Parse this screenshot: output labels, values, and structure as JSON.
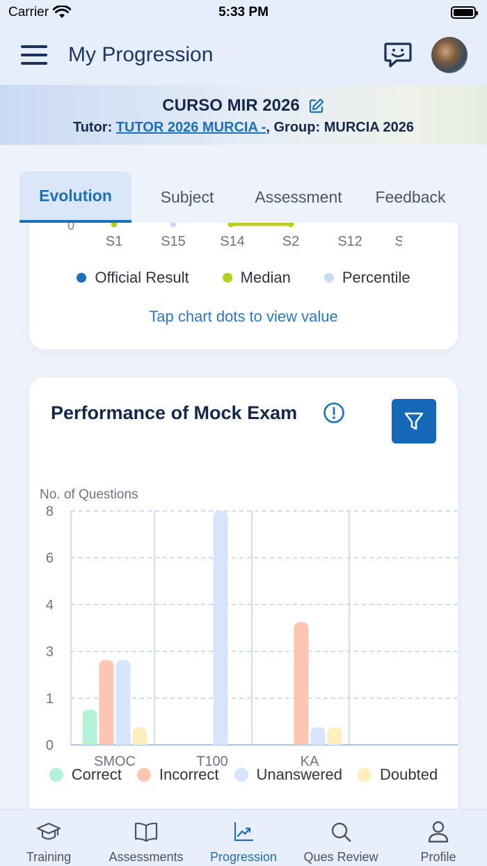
{
  "status_bar": {
    "carrier": "Carrier",
    "time": "5:33 PM"
  },
  "header": {
    "title": "My Progression",
    "menu_icon": "hamburger-menu-icon",
    "chat_icon": "chat-smile-icon"
  },
  "course": {
    "name": "CURSO MIR 2026",
    "tutor_prefix": "Tutor: ",
    "tutor_name": "TUTOR 2026 MURCIA -",
    "group_text": ", Group: MURCIA 2026"
  },
  "tabs": [
    {
      "label": "Evolution",
      "active": true
    },
    {
      "label": "Subject",
      "active": false
    },
    {
      "label": "Assessment",
      "active": false
    },
    {
      "label": "Feedback",
      "active": false
    }
  ],
  "evolution_card": {
    "y_tick_visible": "0",
    "x_labels": [
      "S1",
      "S15",
      "S14",
      "S2",
      "S12",
      "S"
    ],
    "legend": [
      {
        "label": "Official Result",
        "color": "#1d6fb8"
      },
      {
        "label": "Median",
        "color": "#b8cc22"
      },
      {
        "label": "Percentile",
        "color": "#c9dbf7"
      }
    ],
    "hint": "Tap chart dots to view value"
  },
  "performance_card": {
    "title": "Performance of Mock Exam",
    "info_icon": "info-circle-icon",
    "filter_icon": "filter-funnel-icon"
  },
  "chart_data": {
    "type": "bar",
    "title": "Performance of Mock Exam",
    "ylabel": "No. of Questions",
    "xlabel": "",
    "categories": [
      "SMOC",
      "T100",
      "KA"
    ],
    "y_ticks": [
      "0",
      "1",
      "3",
      "4",
      "6",
      "8"
    ],
    "ylim": [
      0,
      8
    ],
    "grid": true,
    "legend_position": "bottom",
    "series": [
      {
        "name": "Correct",
        "color": "#b5f0d8",
        "values": [
          1.2,
          0,
          0
        ]
      },
      {
        "name": "Incorrect",
        "color": "#fcc6b3",
        "values": [
          2.9,
          0,
          4.2
        ]
      },
      {
        "name": "Unanswered",
        "color": "#d6e5fb",
        "values": [
          2.9,
          8,
          0.6
        ]
      },
      {
        "name": "Doubted",
        "color": "#fdefbf",
        "values": [
          0.6,
          0,
          0.6
        ]
      }
    ]
  },
  "bottom_nav": [
    {
      "label": "Training",
      "icon": "graduation-cap-icon",
      "active": false
    },
    {
      "label": "Assessments",
      "icon": "open-book-icon",
      "active": false
    },
    {
      "label": "Progression",
      "icon": "line-chart-icon",
      "active": true
    },
    {
      "label": "Ques Review",
      "icon": "search-icon",
      "active": false
    },
    {
      "label": "Profile",
      "icon": "user-icon",
      "active": false
    }
  ]
}
